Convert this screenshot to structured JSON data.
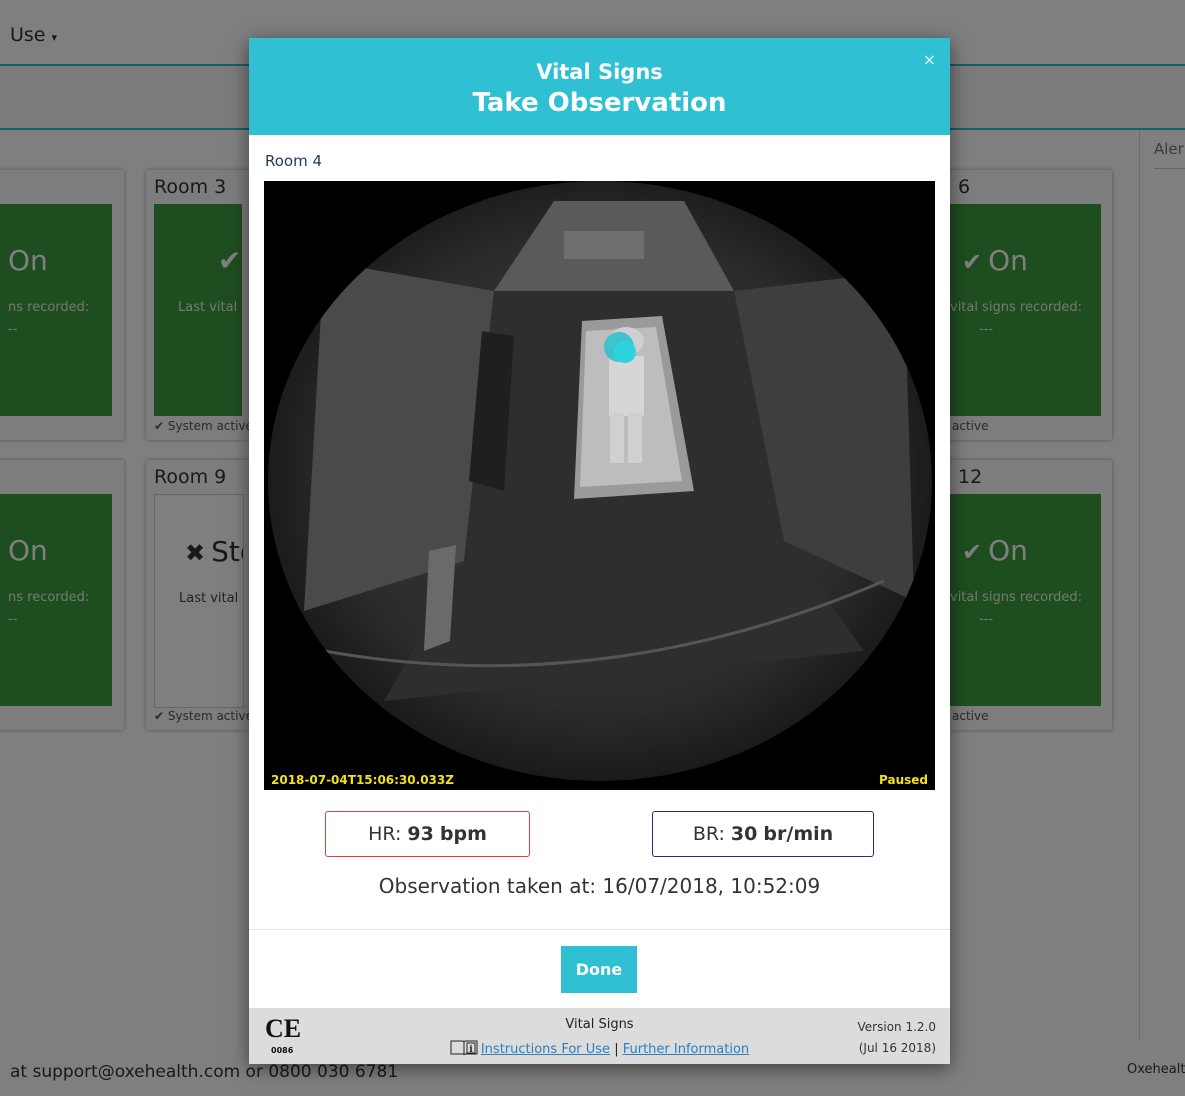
{
  "nav": {
    "menu_label": "Use",
    "alerts_label": "Aler"
  },
  "rooms": [
    {
      "title": "",
      "status": "On",
      "last_label": "ns recorded:",
      "last_value": "--",
      "system": ""
    },
    {
      "title": "Room 3",
      "status": "",
      "last_label": "Last vital si",
      "last_value": "",
      "system": "System active"
    },
    {
      "title": "6",
      "status": "On",
      "last_label": "vital signs recorded:",
      "last_value": "---",
      "system": "active"
    },
    {
      "title": "",
      "status": "On",
      "last_label": "ns recorded:",
      "last_value": "--",
      "system": ""
    },
    {
      "title": "Room 9",
      "status": "Sto",
      "last_label": "Last vital si",
      "last_value": "",
      "system": "System active"
    },
    {
      "title": "12",
      "status": "On",
      "last_label": "vital signs recorded:",
      "last_value": "---",
      "system": "active"
    }
  ],
  "footer": {
    "support_text": "at support@oxehealth.com or 0800 030 6781",
    "brand": "Oxehealth"
  },
  "modal": {
    "subtitle": "Vital Signs",
    "title": "Take Observation",
    "close_label": "×",
    "room_label": "Room 4",
    "camera": {
      "timestamp": "2018-07-04T15:06:30.033Z",
      "state": "Paused"
    },
    "hr": {
      "label": "HR:",
      "value": "93",
      "unit": "bpm"
    },
    "br": {
      "label": "BR:",
      "value": "30",
      "unit": "br/min"
    },
    "observation_text": "Observation taken at: 16/07/2018, 10:52:09",
    "done_label": "Done",
    "footer": {
      "ce_mark": "CE",
      "ce_number": "0086",
      "product": "Vital Signs",
      "instructions_link": "Instructions For Use",
      "separator": "|",
      "info_link": "Further Information",
      "version": "Version 1.2.0",
      "version_date": "(Jul 16 2018)"
    }
  },
  "colors": {
    "accent": "#2fc1d3",
    "room_green": "#3d9a3f",
    "hr_border": "#d9443d",
    "br_border": "#2a2a8c",
    "overlay_text": "#f0e020"
  }
}
